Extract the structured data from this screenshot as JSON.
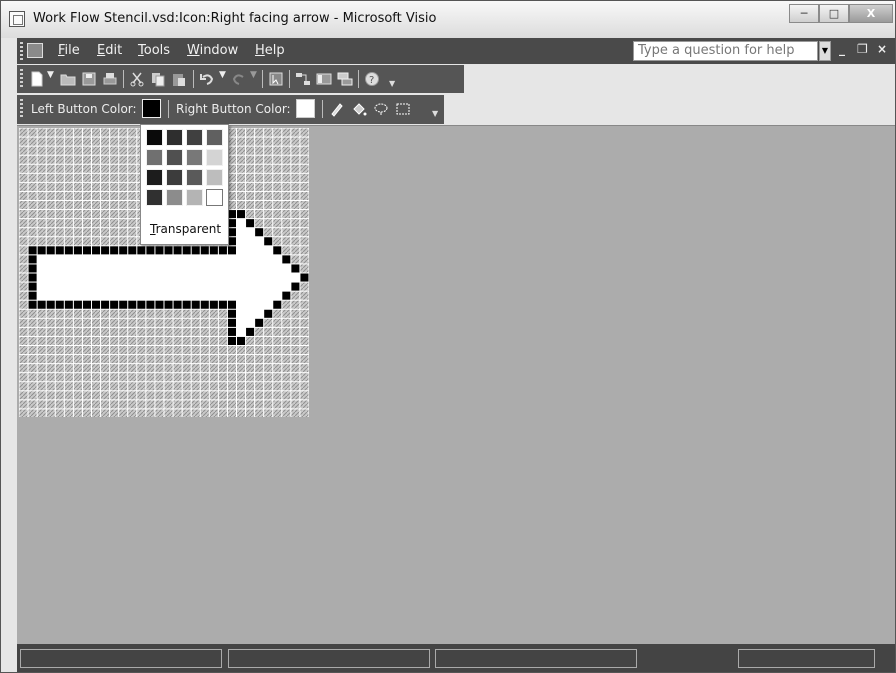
{
  "window": {
    "title": "Work Flow Stencil.vsd:Icon:Right facing arrow - Microsoft Visio"
  },
  "menubar": {
    "items": [
      {
        "label": "File",
        "u": "F",
        "rest": "ile"
      },
      {
        "label": "Edit",
        "u": "E",
        "rest": "dit"
      },
      {
        "label": "Tools",
        "u": "T",
        "rest": "ools"
      },
      {
        "label": "Window",
        "u": "W",
        "rest": "indow"
      },
      {
        "label": "Help",
        "u": "H",
        "rest": "elp"
      }
    ],
    "help_placeholder": "Type a question for help"
  },
  "standard_toolbar": {
    "icons": [
      "new-icon",
      "open-icon",
      "save-icon",
      "print-icon",
      "cut-icon",
      "copy-icon",
      "paste-icon",
      "undo-icon",
      "redo-icon",
      "pointer-icon",
      "connector-icon",
      "shapes-window-icon",
      "layers-icon",
      "help-icon"
    ]
  },
  "icon_editor_toolbar": {
    "left_button_color_label": "Left Button Color:",
    "right_button_color_label": "Right Button Color:",
    "left_color": "#000000",
    "right_color": "#ffffff",
    "tools": [
      "pencil-icon",
      "fill-bucket-icon",
      "lasso-icon",
      "selection-rectangle-icon"
    ]
  },
  "color_popup": {
    "colors": [
      "#0a0a0a",
      "#2e2e2e",
      "#404040",
      "#606060",
      "#707070",
      "#505050",
      "#787878",
      "#d4d4d4",
      "#1c1c1c",
      "#3c3c3c",
      "#5a5a5a",
      "#bdbdbd",
      "#303030",
      "#8c8c8c",
      "#b4b4b4",
      "#ffffff"
    ],
    "transparent_label": "Transparent",
    "transparent_u": "T",
    "transparent_rest": "ransparent"
  },
  "icon_grid": {
    "size": 32,
    "background_pattern": "hatched-transparent",
    "image": "right-facing-arrow"
  }
}
